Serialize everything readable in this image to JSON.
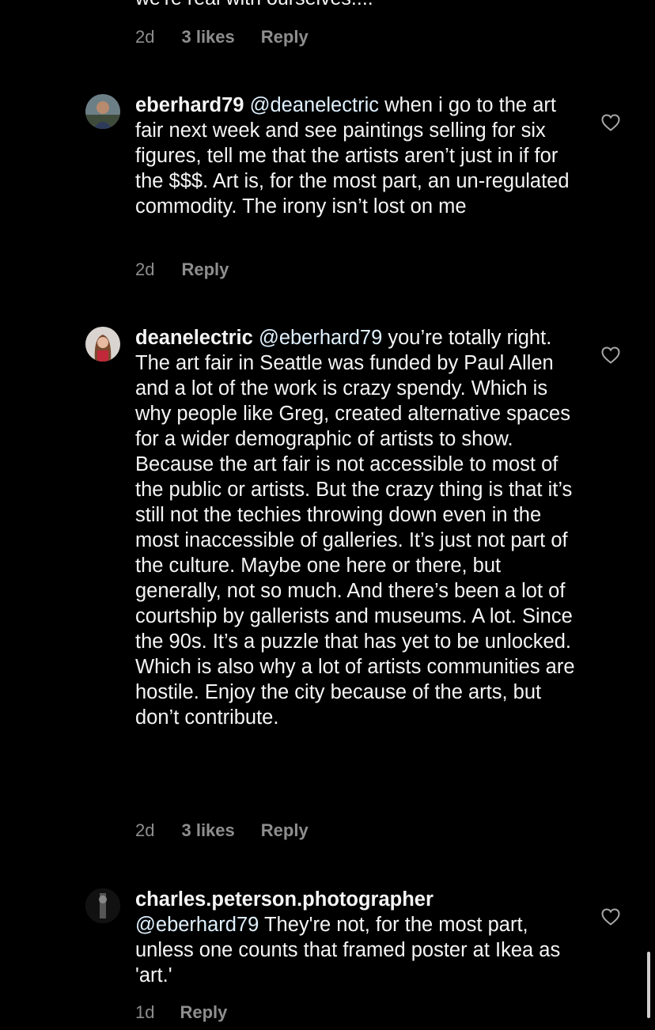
{
  "top_fragment": {
    "clipped_text": "we're real with ourselves....",
    "time": "2d",
    "likes": "3 likes",
    "reply": "Reply"
  },
  "comments": [
    {
      "username": "eberhard79",
      "mention": "@deanelectric",
      "text": " when i go to the art fair next week and see paintings selling for six figures, tell me that the artists aren’t just in if for the $$$. Art is, for the most part, an un-regulated commodity. The irony isn’t lost on me",
      "time": "2d",
      "reply": "Reply"
    },
    {
      "username": "deanelectric",
      "mention": "@eberhard79",
      "text": " you’re totally right. The art fair in Seattle was funded by Paul Allen and a lot of the work is crazy spendy. Which is why people like Greg, created alternative spaces for a wider demographic of artists to show. Because the art fair is not accessible to most of the public or artists. But the crazy thing is that it’s still not the techies throwing down even in the most inaccessible of galleries. It’s just not part of the culture. Maybe one here or there, but generally, not so much. And there’s been a lot of courtship by gallerists and museums. A lot. Since the 90s. It’s a puzzle that has yet to be unlocked. Which is also why a lot of artists communities are hostile. Enjoy the city because of the arts, but don’t contribute.",
      "time": "2d",
      "likes": "3 likes",
      "reply": "Reply"
    },
    {
      "username": "charles.peterson.photographer",
      "mention": "@eberhard79",
      "text": " They're not, for the most part, unless one counts that framed poster at Ikea as 'art.'",
      "time": "1d",
      "reply": "Reply"
    }
  ],
  "icons": {
    "like": "heart-outline-icon"
  },
  "colors": {
    "background": "#000000",
    "text": "#f5f5f5",
    "secondary": "#8e8e8e",
    "mention": "#e0f1ff"
  }
}
